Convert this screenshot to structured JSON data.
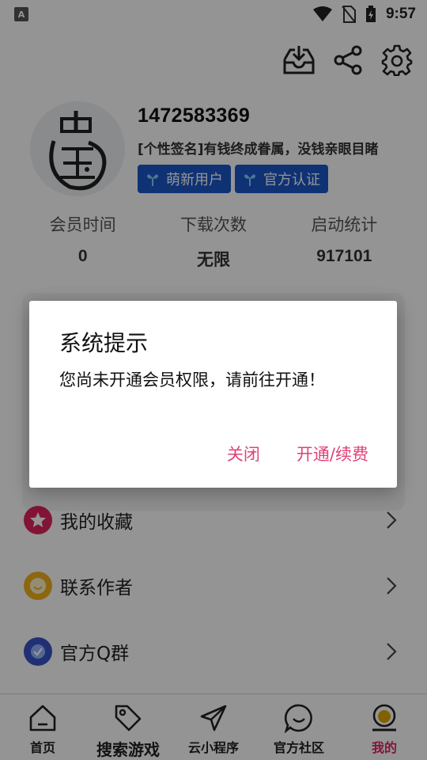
{
  "status_bar": {
    "app_icon_letter": "A",
    "time": "9:57"
  },
  "top_actions": {
    "icons": [
      "download-tray-icon",
      "share-icon",
      "settings-gear-icon"
    ]
  },
  "profile": {
    "username": "1472583369",
    "signature": "[个性签名]有钱终成眷属，没钱亲眼目睹",
    "avatar_text": "中玉",
    "badges": [
      {
        "label": "萌新用户",
        "icon": "flower-icon"
      },
      {
        "label": "官方认证",
        "icon": "flower-icon"
      }
    ]
  },
  "stats": [
    {
      "label": "会员时间",
      "value": "0"
    },
    {
      "label": "下载次数",
      "value": "无限"
    },
    {
      "label": "启动统计",
      "value": "917101"
    }
  ],
  "menu": [
    {
      "label": "我的收藏",
      "icon": "star-icon",
      "color": "#e0245e"
    },
    {
      "label": "联系作者",
      "icon": "smile-icon",
      "color": "#f2b21b"
    },
    {
      "label": "官方Q群",
      "icon": "badge-check-icon",
      "color": "#3a53c9"
    }
  ],
  "bottom_nav": [
    {
      "label": "首页",
      "icon": "home-icon"
    },
    {
      "label": "搜索游戏",
      "icon": "tag-icon"
    },
    {
      "label": "云小程序",
      "icon": "paper-plane-icon"
    },
    {
      "label": "官方社区",
      "icon": "chat-smile-icon"
    },
    {
      "label": "我的",
      "icon": "user-icon",
      "active": true
    }
  ],
  "dialog": {
    "title": "系统提示",
    "message": "您尚未开通会员权限，请前往开通！",
    "close_label": "关闭",
    "renew_label": "开通/续费"
  },
  "colors": {
    "accent": "#e0427a",
    "badge_blue": "#1a57c9",
    "overlay": "rgba(0,0,0,0.42)"
  }
}
